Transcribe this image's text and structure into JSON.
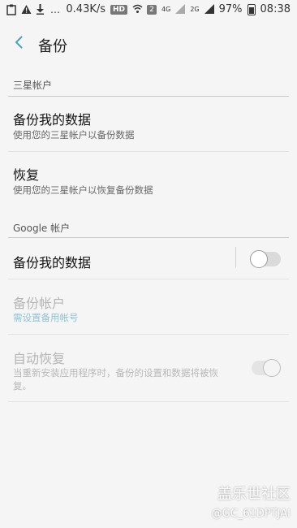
{
  "status_bar": {
    "speed": "0.43K/s",
    "hd": "HD",
    "sim": "2",
    "net1": "4G",
    "net2": "2G",
    "battery": "97%",
    "time": "08:38"
  },
  "header": {
    "title": "备份"
  },
  "samsung_section": {
    "label": "三星帐户",
    "items": [
      {
        "title": "备份我的数据",
        "subtitle": "使用您的三星帐户以备份数据"
      },
      {
        "title": "恢复",
        "subtitle": "使用您的三星帐户以恢复备份数据"
      }
    ]
  },
  "google_section": {
    "label": "Google 帐户",
    "backup_data": {
      "title": "备份我的数据",
      "toggle_on": false
    },
    "backup_account": {
      "title": "备份帐户",
      "subtitle": "需设置备用帐号"
    },
    "auto_restore": {
      "title": "自动恢复",
      "subtitle_line1": "当重新安装应用程序时，备份的设置和数据将被恢",
      "subtitle_line2": "复。",
      "toggle_on": true
    }
  },
  "watermark": {
    "line1": "盖乐世社区",
    "line2": "@GC_61DPTJAI"
  }
}
